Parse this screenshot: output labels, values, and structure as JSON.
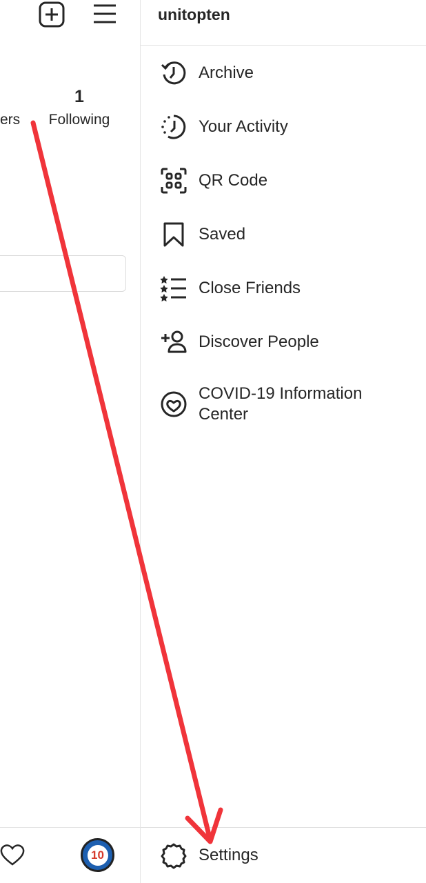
{
  "profile": {
    "following_count": "1",
    "following_label": "Following",
    "followers_label_partial": "ers"
  },
  "drawer": {
    "username": "unitopten",
    "items": [
      {
        "label": "Archive",
        "icon": "archive-icon"
      },
      {
        "label": "Your Activity",
        "icon": "activity-icon"
      },
      {
        "label": "QR Code",
        "icon": "qr-code-icon"
      },
      {
        "label": "Saved",
        "icon": "bookmark-icon"
      },
      {
        "label": "Close Friends",
        "icon": "close-friends-icon"
      },
      {
        "label": "Discover People",
        "icon": "add-person-icon"
      },
      {
        "label": "COVID-19 Information Center",
        "icon": "covid-info-icon"
      }
    ],
    "settings_label": "Settings"
  },
  "avatar_text": "10",
  "colors": {
    "annotation_arrow": "#f0343a",
    "avatar_ring": "#1d5fb0",
    "avatar_text": "#d63a2c"
  }
}
